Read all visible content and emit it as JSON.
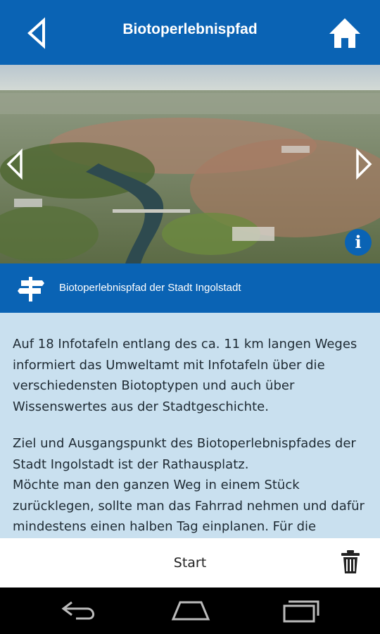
{
  "header": {
    "title": "Biotoperlebnispfad"
  },
  "icons": {
    "back": "back-arrow-icon",
    "home": "home-icon",
    "prev": "chevron-left-icon",
    "next": "chevron-right-icon",
    "info": "info-icon",
    "signpost": "signpost-icon",
    "trash": "trash-icon"
  },
  "info_label": "i",
  "banner": {
    "label": "Biotoperlebnispfad der Stadt Ingolstadt"
  },
  "content": {
    "paragraph1": "Auf 18 Infotafeln entlang des ca. 11 km langen Weges informiert das Umweltamt mit Infotafeln über die verschiedensten Biotoptypen und auch über Wissenswertes aus der Stadtgeschichte.",
    "paragraph2_line1": "Ziel und Ausgangspunkt des Biotoperlebnispfades der Stadt Ingolstadt ist der Rathausplatz.",
    "paragraph2_line2": "Möchte man den ganzen Weg in einem Stück zurücklegen, sollte man das Fahrrad nehmen und dafür mindestens einen halben Tag einplanen. Für die"
  },
  "bottom": {
    "start_label": "Start"
  },
  "colors": {
    "primary": "#0a63b4",
    "content_bg": "#c9e0ef",
    "text": "#1e2a33"
  }
}
